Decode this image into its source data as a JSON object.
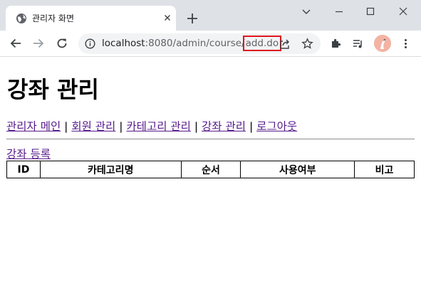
{
  "browser": {
    "tab_title": "관리자 화면",
    "url_host": "localhost",
    "url_port_path": ":8080/admin/course/",
    "url_highlight": "add.do"
  },
  "page": {
    "title": "강좌 관리",
    "nav": [
      {
        "label": "관리자 메인"
      },
      {
        "label": "회원 관리"
      },
      {
        "label": "카테고리 관리"
      },
      {
        "label": "강좌 관리"
      },
      {
        "label": "로그아웃"
      }
    ],
    "separator": "|",
    "add_link": "강좌 등록",
    "table_headers": [
      "ID",
      "카테고리명",
      "순서",
      "사용여부",
      "비고"
    ]
  },
  "colors": {
    "highlight_box": "#e0161e",
    "visited_link": "#551a8b"
  }
}
